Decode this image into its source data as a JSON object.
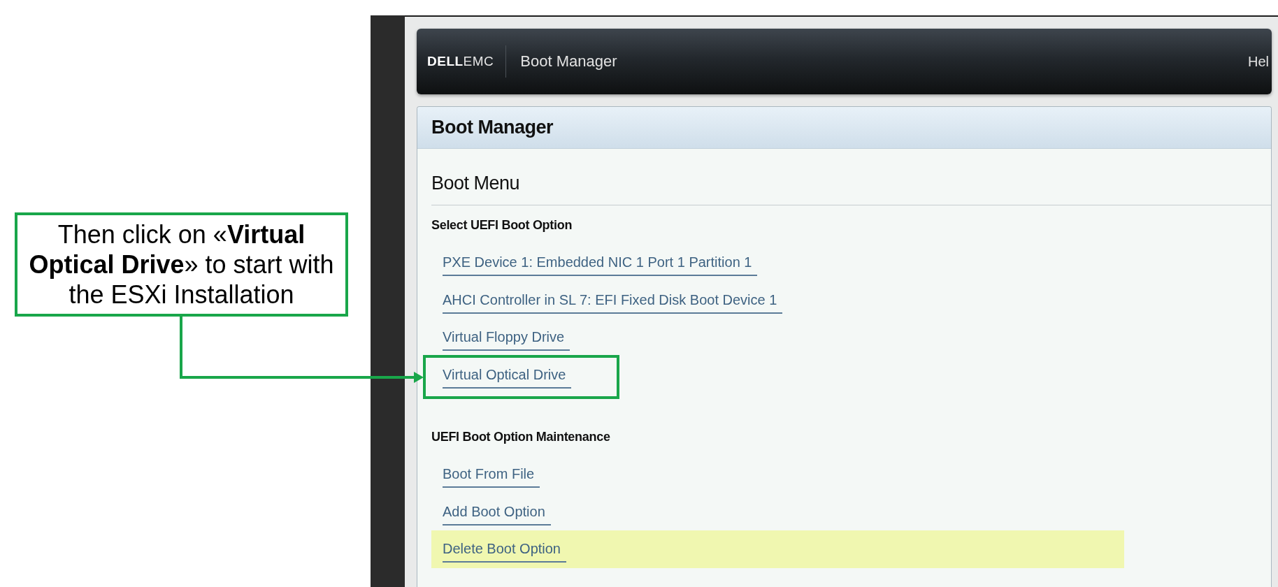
{
  "callout": {
    "text": "Then click on «**Virtual Optical Drive**» to start with the ESXi Installation"
  },
  "header": {
    "logo": "**DELL**EMC",
    "title": "Boot Manager",
    "help": "Hel"
  },
  "panel": {
    "title": "Boot Manager",
    "heading": "Boot Menu",
    "sections": [
      {
        "title": "Select UEFI Boot Option",
        "items": [
          {
            "label": "PXE Device 1: Embedded NIC 1 Port 1 Partition 1",
            "selected": false,
            "annotated": false
          },
          {
            "label": "AHCI Controller in SL 7: EFI Fixed Disk Boot Device 1",
            "selected": false,
            "annotated": false
          },
          {
            "label": "Virtual Floppy Drive",
            "selected": false,
            "annotated": false
          },
          {
            "label": "Virtual Optical Drive",
            "selected": false,
            "annotated": true
          }
        ]
      },
      {
        "title": "UEFI Boot Option Maintenance",
        "items": [
          {
            "label": "Boot From File",
            "selected": false,
            "annotated": false
          },
          {
            "label": "Add Boot Option",
            "selected": false,
            "annotated": false
          },
          {
            "label": "Delete Boot Option",
            "selected": true,
            "annotated": false
          }
        ]
      }
    ]
  }
}
